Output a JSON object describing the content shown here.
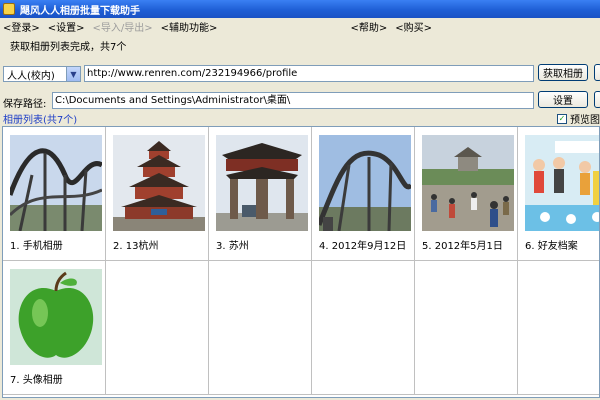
{
  "window": {
    "title": "飓风人人相册批量下载助手"
  },
  "menu": [
    {
      "label": "<登录>",
      "disabled": false
    },
    {
      "label": "<设置>",
      "disabled": false
    },
    {
      "label": "<导入/导出>",
      "disabled": true
    },
    {
      "label": "<辅助功能>",
      "disabled": false
    },
    {
      "label": "<帮助>",
      "disabled": false
    },
    {
      "label": "<购买>",
      "disabled": false
    }
  ],
  "status": "获取相册列表完成，共7个",
  "account": {
    "selected": "人人(校内)"
  },
  "url": {
    "value": "http://www.renren.com/232194966/profile"
  },
  "fetch_button": "获取相册",
  "save_path": {
    "label": "保存路径:",
    "value": "C:\\Documents and Settings\\Administrator\\桌面\\"
  },
  "settings_button": "设置",
  "album_list": {
    "title": "相册列表(共7个)"
  },
  "preview": {
    "label": "预览图",
    "checked": true
  },
  "albums": [
    {
      "caption": "1. 手机相册",
      "thumb": "roller-coaster-photo"
    },
    {
      "caption": "2. 13杭州",
      "thumb": "pagoda-photo"
    },
    {
      "caption": "3. 苏州",
      "thumb": "archway-photo"
    },
    {
      "caption": "4. 2012年9月12日",
      "thumb": "roller-coaster-photo"
    },
    {
      "caption": "5. 2012年5月1日",
      "thumb": "plaza-crowd-photo"
    },
    {
      "caption": "6. 好友档案",
      "thumb": "profile-collage-photo"
    },
    {
      "caption": "7. 头像相册",
      "thumb": "green-apple-photo"
    }
  ]
}
